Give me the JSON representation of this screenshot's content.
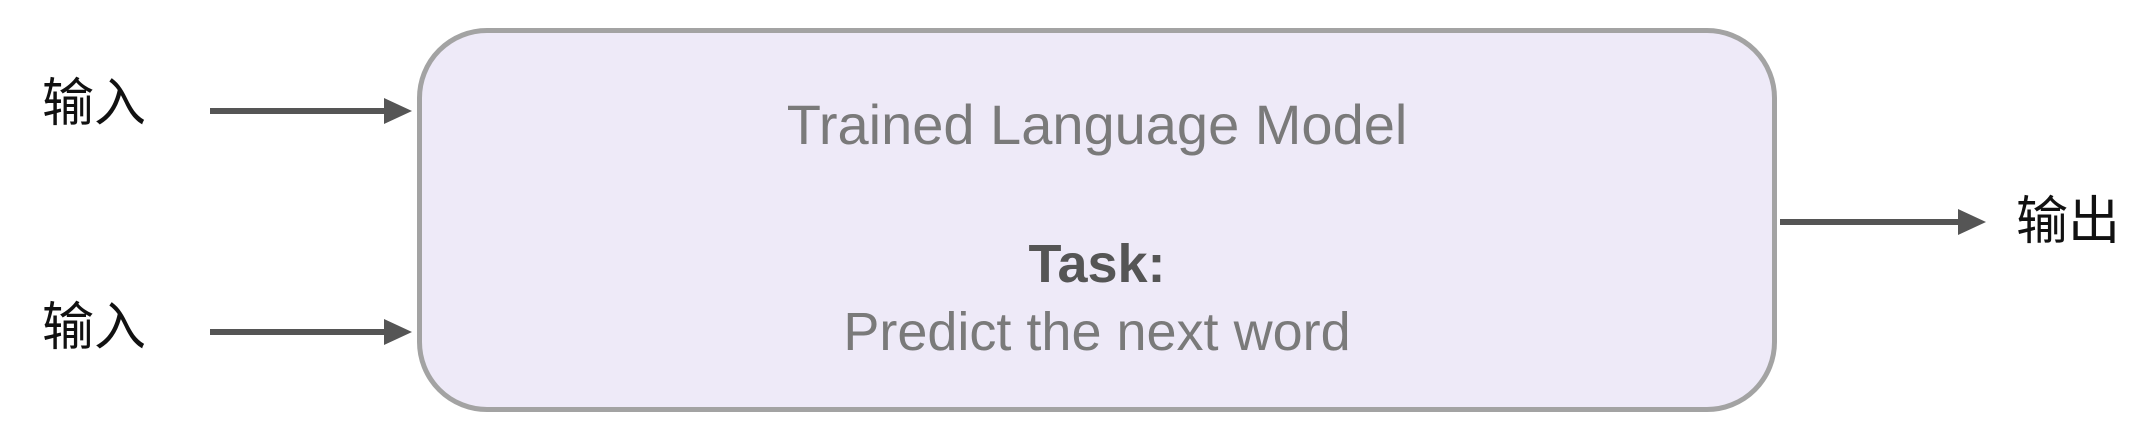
{
  "inputs": [
    {
      "label": "输入"
    },
    {
      "label": "输入"
    }
  ],
  "output": {
    "label": "输出"
  },
  "model": {
    "title": "Trained Language Model",
    "task_heading": "Task:",
    "task_description": "Predict the next word"
  },
  "colors": {
    "box_fill": "#eeeaf8",
    "box_border": "#a3a3a3",
    "arrow": "#555555",
    "label_text": "#111111"
  },
  "icons": {
    "arrow": "arrow-right-icon"
  }
}
